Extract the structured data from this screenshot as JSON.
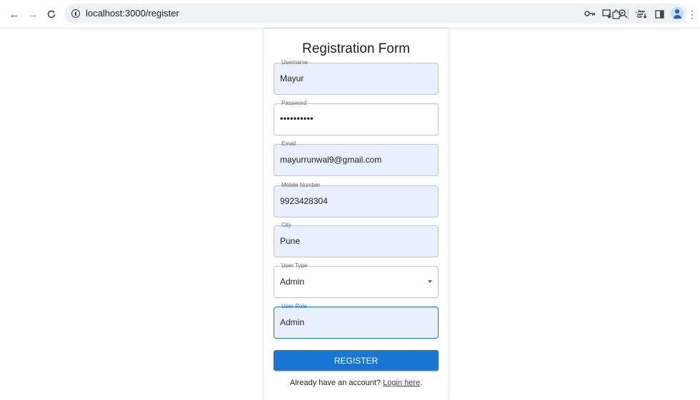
{
  "browser": {
    "url": "localhost:3000/register",
    "icons": [
      "back-icon",
      "forward-icon",
      "reload-icon",
      "site-info-icon",
      "key-icon",
      "install-icon",
      "zoom-icon",
      "bookmark-star-icon",
      "extensions-icon",
      "reading-list-icon",
      "side-panel-icon",
      "profile-avatar",
      "menu-icon"
    ]
  },
  "form": {
    "title": "Registration Form",
    "fields": [
      {
        "label": "Username",
        "value": "Mayur"
      },
      {
        "label": "Password",
        "value": "••••••••••"
      },
      {
        "label": "Email",
        "value": "mayurrunwal9@gmail.com"
      },
      {
        "label": "Mobile Number",
        "value": "9923428304"
      },
      {
        "label": "City",
        "value": "Pune"
      },
      {
        "label": "User Type",
        "value": "Admin"
      },
      {
        "label": "User Role",
        "value": "Admin"
      }
    ],
    "submit_label": "REGISTER",
    "footer_text": "Already have an account? ",
    "login_link": "Login here",
    "footer_end": "."
  },
  "colors": {
    "accent": "#1976d2",
    "autofill_bg": "#e8f0fe",
    "link": "#5b1fa6"
  }
}
